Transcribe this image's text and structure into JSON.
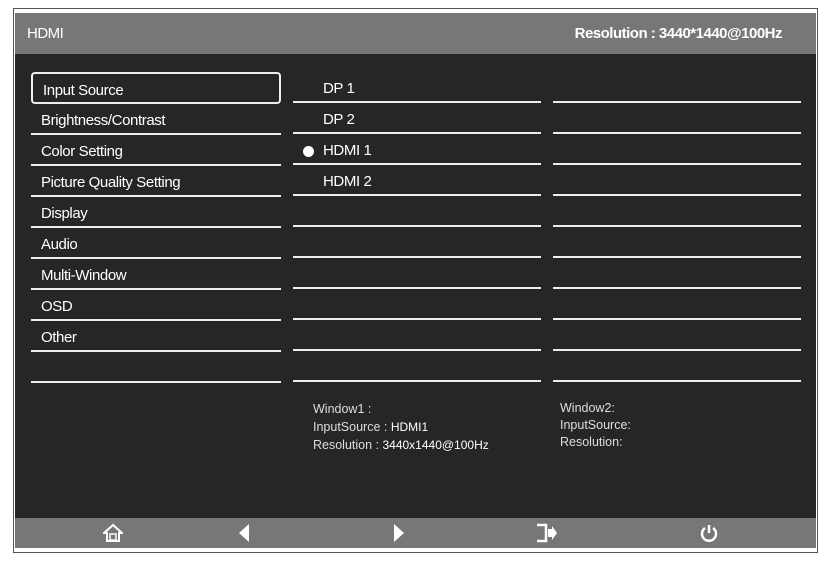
{
  "header": {
    "title": "HDMI",
    "resolution": "Resolution :  3440*1440@100Hz"
  },
  "menu": [
    "Input Source",
    "Brightness/Contrast",
    "Color Setting",
    "Picture Quality Setting",
    "Display",
    "Audio",
    "Multi-Window",
    "OSD",
    "Other",
    ""
  ],
  "sources": [
    {
      "label": "DP 1",
      "selected": false
    },
    {
      "label": "DP 2",
      "selected": false
    },
    {
      "label": "HDMI 1",
      "selected": true
    },
    {
      "label": "HDMI 2",
      "selected": false
    }
  ],
  "window1": {
    "title": "Window1 :",
    "input_label": "InputSource : ",
    "input_value": "HDMI1",
    "res_label": "Resolution : ",
    "res_value": "3440x1440@100Hz"
  },
  "window2": {
    "title": "Window2:",
    "input_label": "InputSource:",
    "res_label": "Resolution:"
  },
  "footer": [
    "home-icon",
    "left-arrow-icon",
    "right-arrow-icon",
    "exit-icon",
    "power-icon"
  ]
}
